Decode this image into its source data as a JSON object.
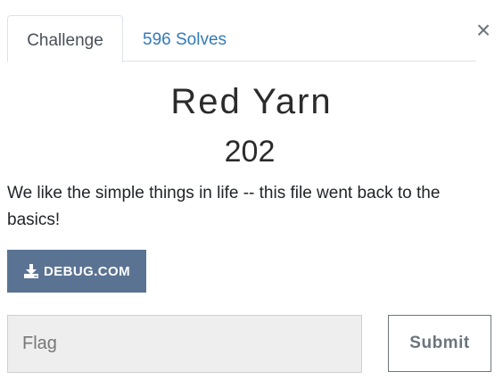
{
  "tabs": {
    "challenge_label": "Challenge",
    "solves_label": "596 Solves"
  },
  "close": {
    "icon": "close-icon",
    "glyph": "×"
  },
  "challenge": {
    "name": "Red Yarn",
    "points": "202",
    "description": "We like the simple things in life -- this file went back to the basics!"
  },
  "file": {
    "icon": "download-icon",
    "label": "DEBUG.COM"
  },
  "flag_form": {
    "placeholder": "Flag",
    "value": "",
    "submit_label": "Submit"
  },
  "colors": {
    "file_button_bg": "#5b7393",
    "link": "#337ab7",
    "input_bg": "#eeeeee"
  }
}
